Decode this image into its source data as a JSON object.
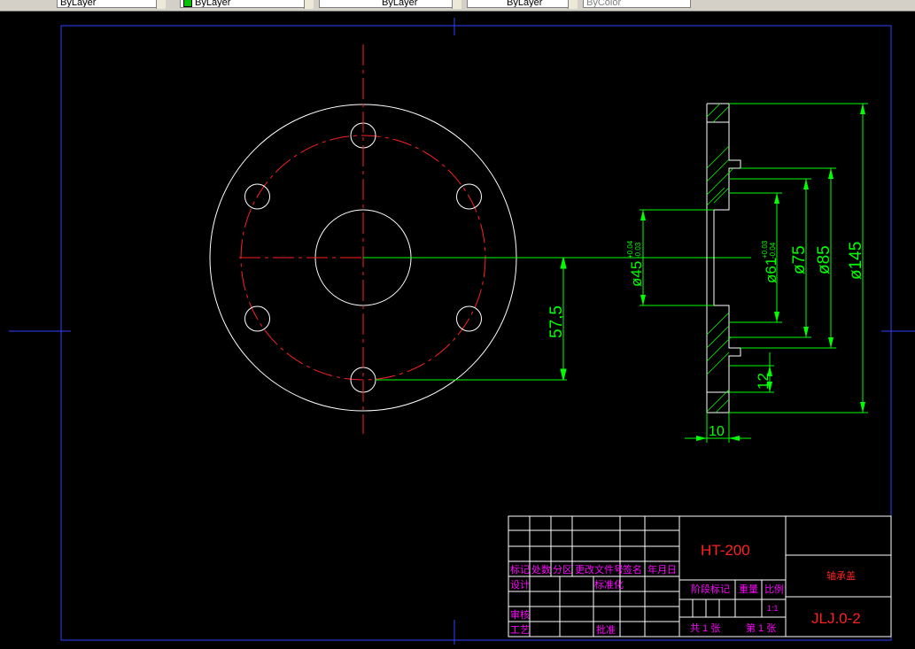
{
  "toolbar": {
    "combos": [
      "ByLayer",
      "ByLayer",
      "ByLayer",
      "ByLayer",
      "ByColor"
    ]
  },
  "drawing": {
    "dims": {
      "d45": "ø45",
      "d45_tol_upper": "+0.04",
      "d45_tol_lower": "-0.03",
      "dim_57_5": "57,5",
      "d61": "ø61",
      "d61_tol_upper": "+0.03",
      "d61_tol_lower": "-0.04",
      "d75": "ø75",
      "d85": "ø85",
      "d145": "ø145",
      "dim_12": "12",
      "dim_10": "10"
    },
    "title_block": {
      "material": "HT-200",
      "part_name": "轴承盖",
      "drawing_no": "JLJ.0-2",
      "header_labels": [
        "标记",
        "处数",
        "分区",
        "更改文件号",
        "签名",
        "年月日"
      ],
      "design": "设计",
      "standardize": "标准化",
      "stage_mark": "阶段标记",
      "weight": "重量",
      "scale": "比例",
      "scale_value": "1:1",
      "review": "审核",
      "process": "工艺",
      "approve": "批准",
      "total_sheets": "共 1 张",
      "sheet_no": "第 1 张"
    }
  },
  "colors": {
    "white": "#ffffff",
    "red": "#ff0000",
    "green": "#00ff00",
    "blue": "#0000ff",
    "magenta": "#ff00ff"
  }
}
